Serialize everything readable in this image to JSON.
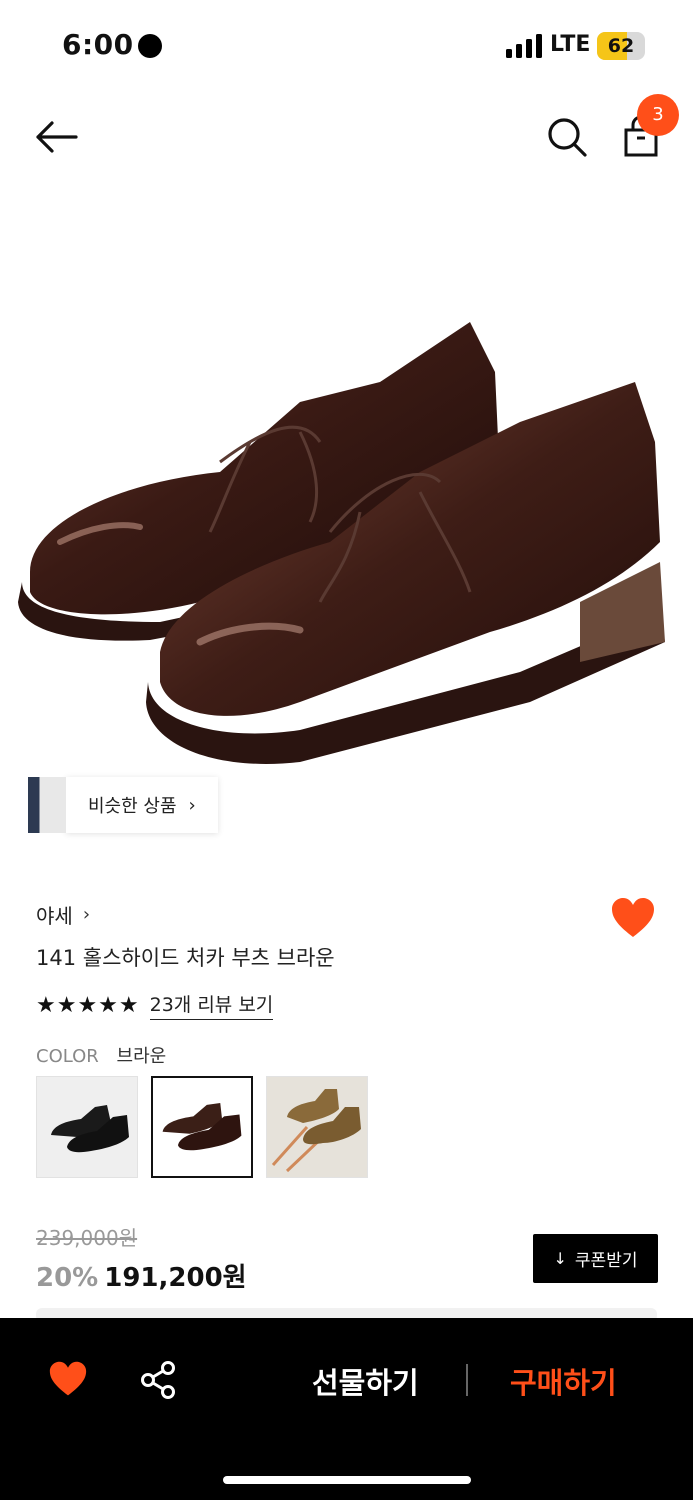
{
  "status_bar": {
    "time": "6:00",
    "network": "LTE",
    "battery": "62",
    "battery_level": 0.62
  },
  "nav": {
    "cart_count": "3"
  },
  "similar": {
    "label": "비슷한 상품",
    "chevron": "›"
  },
  "product": {
    "brand": "야세",
    "brand_chevron": "›",
    "name": "141 홀스하이드 처카 부츠 브라운",
    "stars": "★★★★★",
    "rating": 5,
    "review_link": "23개 리뷰 보기",
    "color_label": "COLOR",
    "color_value": "브라운",
    "colors": [
      {
        "name": "black",
        "hex": "#1a1a1a"
      },
      {
        "name": "brown",
        "hex": "#3b1f17"
      },
      {
        "name": "tan",
        "hex": "#8a6a3a"
      }
    ],
    "original_price": "239,000원",
    "discount": "20%",
    "sale_price": "191,200원",
    "coupon_label": "쿠폰받기",
    "coupon_icon": "↓"
  },
  "bottom_bar": {
    "gift_label": "선물하기",
    "buy_label": "구매하기"
  },
  "colors": {
    "accent": "#ff4f19",
    "bar": "#000000"
  },
  "icons": [
    "back-arrow-icon",
    "search-icon",
    "shopping-bag-icon",
    "heart-icon",
    "share-icon",
    "download-icon",
    "chevron-right-icon"
  ]
}
